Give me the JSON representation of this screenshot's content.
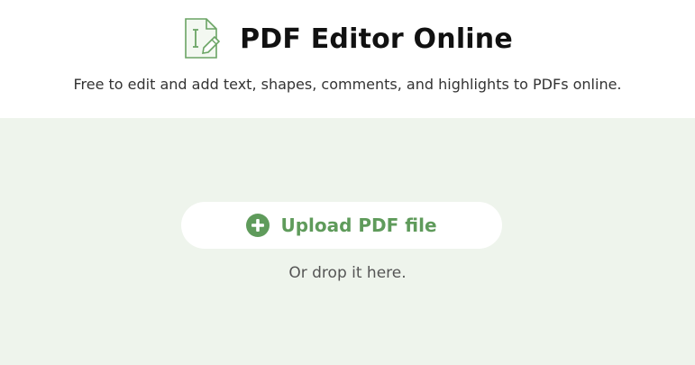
{
  "header": {
    "title": "PDF Editor Online",
    "subtitle": "Free to edit and add text, shapes, comments, and highlights to PDFs online.",
    "logo_icon": "pdf-edit-document-icon"
  },
  "upload": {
    "button_label": "Upload PDF file",
    "button_icon": "plus-circle-icon",
    "drop_hint": "Or drop it here."
  },
  "colors": {
    "accent": "#5f9b5b",
    "dropzone_background": "#eef4ec"
  }
}
